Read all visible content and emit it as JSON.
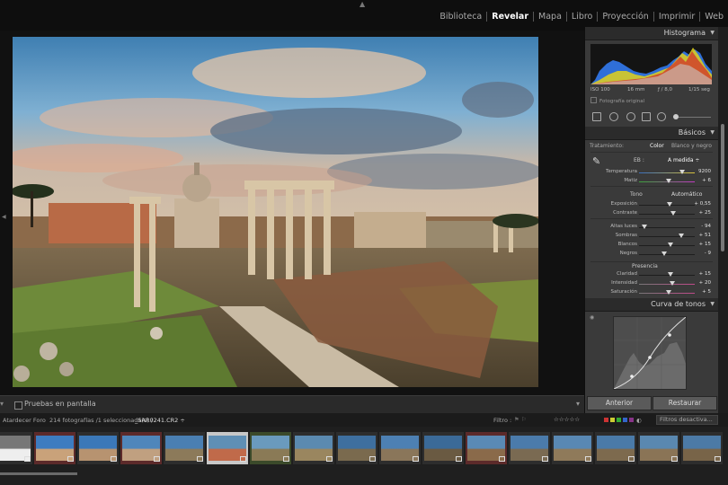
{
  "modules": [
    {
      "label": "Biblioteca",
      "active": false
    },
    {
      "label": "Revelar",
      "active": true
    },
    {
      "label": "Mapa",
      "active": false
    },
    {
      "label": "Libro",
      "active": false
    },
    {
      "label": "Proyección",
      "active": false
    },
    {
      "label": "Imprimir",
      "active": false
    },
    {
      "label": "Web",
      "active": false
    }
  ],
  "histogram": {
    "title": "Histograma",
    "iso": "ISO 100",
    "focal": "16 mm",
    "aperture": "ƒ / 8,0",
    "shutter": "1/15 seg",
    "original_label": "Fotografía original"
  },
  "basics": {
    "title": "Básicos",
    "treatment_label": "Tratamiento:",
    "color_label": "Color",
    "bw_label": "Blanco y negro",
    "wb_label": "EB :",
    "wb_value": "A medida ÷",
    "tone_label": "Tono",
    "auto_label": "Automático",
    "presence_label": "Presencia",
    "wb_sliders": [
      {
        "label": "Temperatura",
        "value": "9200",
        "pos": 0.78
      },
      {
        "label": "Matiz",
        "value": "+ 6",
        "pos": 0.53
      }
    ],
    "tone_sliders": [
      {
        "label": "Exposición",
        "value": "+ 0,55",
        "pos": 0.55
      },
      {
        "label": "Contraste",
        "value": "+ 25",
        "pos": 0.62
      }
    ],
    "tone_sliders_2": [
      {
        "label": "Altas luces",
        "value": "- 94",
        "pos": 0.1
      },
      {
        "label": "Sombras",
        "value": "+ 51",
        "pos": 0.75
      },
      {
        "label": "Blancos",
        "value": "+ 15",
        "pos": 0.57
      },
      {
        "label": "Negros",
        "value": "- 9",
        "pos": 0.45
      }
    ],
    "presence_sliders": [
      {
        "label": "Claridad",
        "value": "+ 15",
        "pos": 0.57
      },
      {
        "label": "Intensidad",
        "value": "+ 20",
        "pos": 0.6
      },
      {
        "label": "Saturación",
        "value": "+ 5",
        "pos": 0.53
      }
    ]
  },
  "curve": {
    "title": "Curva de tonos"
  },
  "buttons": {
    "previous": "Anterior",
    "reset": "Restaurar"
  },
  "toolbar": {
    "soft_proof": "Pruebas en pantalla"
  },
  "filmstrip_bar": {
    "source": "Atardecer Foro",
    "count": "214 fotografías /1 seleccionada(s) /",
    "filename": "_SAR0241.CR2 ÷",
    "filter_label": "Filtro :",
    "filter_off": "Filtros desactiva...",
    "stars": "☆☆☆☆☆"
  },
  "colors": {
    "accent": "#ffffff",
    "panel": "#3a3a3a",
    "header": "#2b2b2b"
  }
}
